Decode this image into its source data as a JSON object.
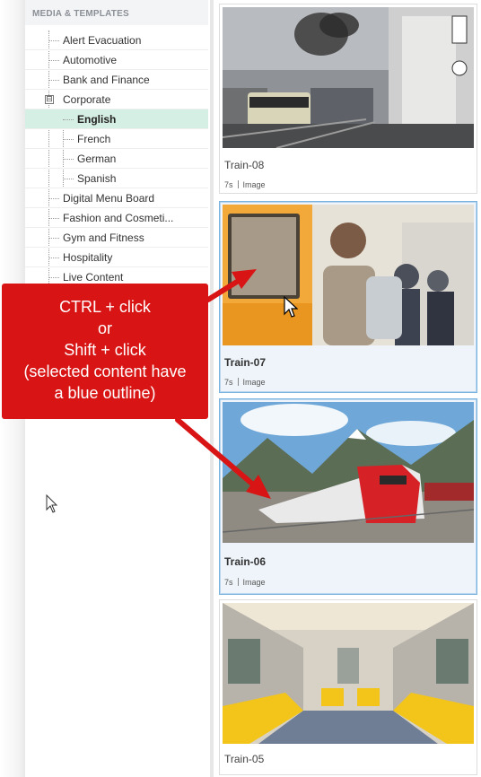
{
  "sidebar": {
    "header": "MEDIA & TEMPLATES",
    "items": [
      {
        "label": "Alert Evacuation"
      },
      {
        "label": "Automotive"
      },
      {
        "label": "Bank and Finance"
      },
      {
        "label": "Corporate",
        "collapse": "⊟"
      },
      {
        "label": "English"
      },
      {
        "label": "French"
      },
      {
        "label": "German"
      },
      {
        "label": "Spanish"
      },
      {
        "label": "Digital Menu Board"
      },
      {
        "label": "Fashion and Cosmeti..."
      },
      {
        "label": "Gym and Fitness"
      },
      {
        "label": "Hospitality"
      },
      {
        "label": "Live Content"
      }
    ]
  },
  "cards": [
    {
      "title": "Train-08",
      "duration": "7s",
      "type": "Image"
    },
    {
      "title": "Train-07",
      "duration": "7s",
      "type": "Image"
    },
    {
      "title": "Train-06",
      "duration": "7s",
      "type": "Image"
    },
    {
      "title": "Train-05"
    }
  ],
  "callout": {
    "lines": [
      "CTRL + click",
      "or",
      "Shift + click",
      "(selected content have",
      "a blue outline)"
    ]
  },
  "colors": {
    "accent_selected_tree": "#d6efe4",
    "selection_outline": "#7ab4de",
    "callout_red": "#d81414"
  }
}
